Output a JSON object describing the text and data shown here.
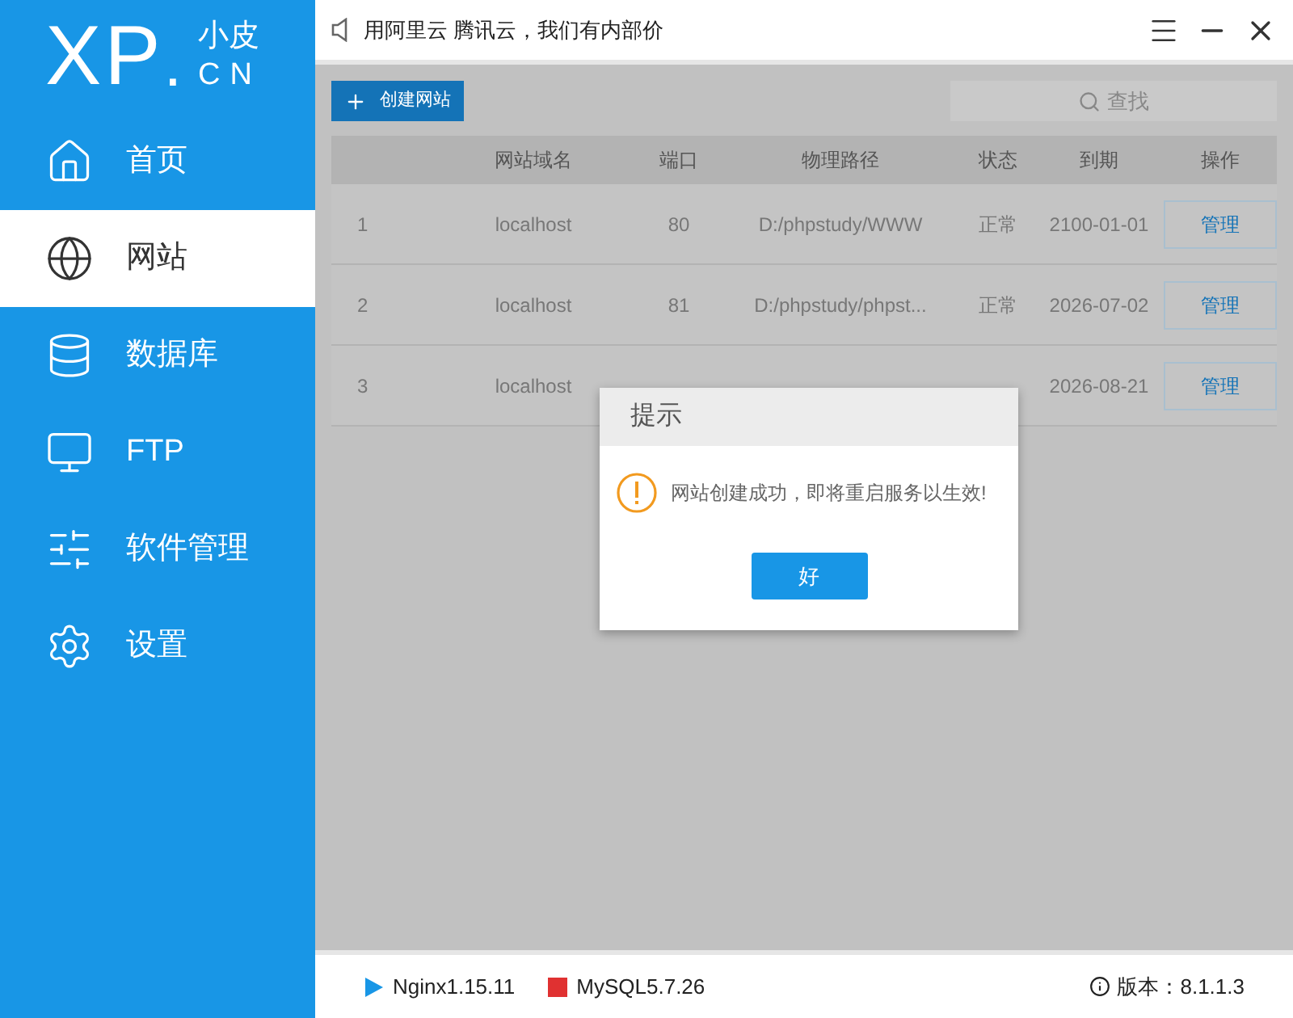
{
  "logo": {
    "mark": "XP",
    "dot": ".",
    "cn_top": "小皮",
    "cn_bottom": "CN"
  },
  "sidebar": {
    "items": [
      {
        "label": "首页",
        "selected": false
      },
      {
        "label": "网站",
        "selected": true
      },
      {
        "label": "数据库",
        "selected": false
      },
      {
        "label": "FTP",
        "selected": false
      },
      {
        "label": "软件管理",
        "selected": false
      },
      {
        "label": "设置",
        "selected": false
      }
    ]
  },
  "notice": "用阿里云 腾讯云，我们有内部价",
  "toolbar": {
    "create_button": "创建网站",
    "search": {
      "placeholder": "查找"
    }
  },
  "table": {
    "columns": [
      "",
      "网站域名",
      "端口",
      "物理路径",
      "状态",
      "到期",
      "操作"
    ],
    "rows": [
      {
        "index": "1",
        "domain": "localhost",
        "port": "80",
        "path": "D:/phpstudy/WWW",
        "status": "正常",
        "expires": "2100-01-01",
        "action": "管理"
      },
      {
        "index": "2",
        "domain": "localhost",
        "port": "81",
        "path": "D:/phpstudy/phpst...",
        "status": "正常",
        "expires": "2026-07-02",
        "action": "管理"
      },
      {
        "index": "3",
        "domain": "localhost",
        "expires": "2026-08-21",
        "action": "管理"
      }
    ]
  },
  "dialog": {
    "title": "提示",
    "message": "网站创建成功，即将重启服务以生效!",
    "button": "好"
  },
  "status_bar": {
    "services": [
      {
        "name": "Nginx1.15.11",
        "kind": "running"
      },
      {
        "name": "MySQL5.7.26",
        "kind": "stopped"
      }
    ],
    "version": "版本：8.1.1.3"
  }
}
